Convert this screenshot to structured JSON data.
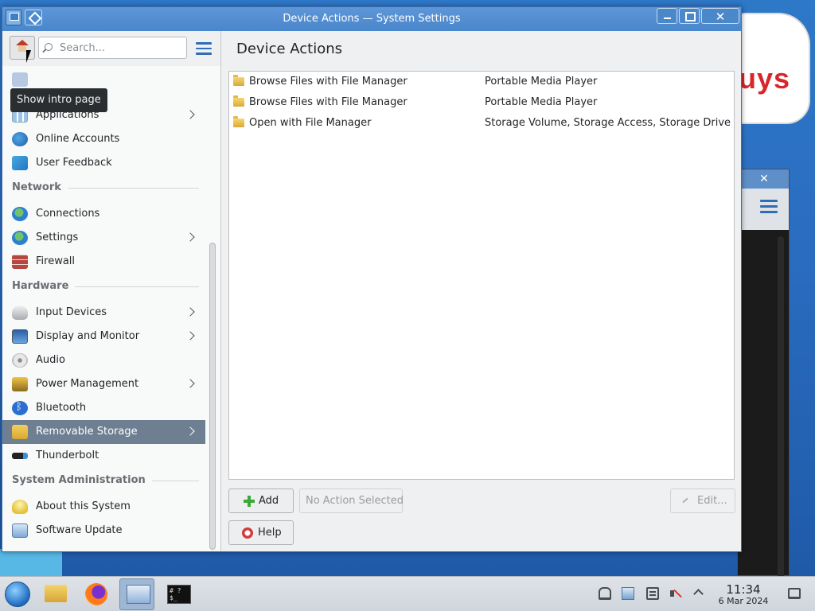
{
  "window": {
    "title": "Device Actions — System Settings"
  },
  "search": {
    "placeholder": "Search..."
  },
  "tooltip": "Show intro page",
  "sidebar": {
    "items": [
      {
        "label": "Applications",
        "icon": "applications-icon",
        "has_children": true
      },
      {
        "label": "Online Accounts",
        "icon": "online-accounts-icon",
        "has_children": false
      },
      {
        "label": "User Feedback",
        "icon": "user-feedback-icon",
        "has_children": false
      },
      {
        "label": "Connections",
        "icon": "connections-icon",
        "has_children": false
      },
      {
        "label": "Settings",
        "icon": "network-settings-icon",
        "has_children": true
      },
      {
        "label": "Firewall",
        "icon": "firewall-icon",
        "has_children": false
      },
      {
        "label": "Input Devices",
        "icon": "input-devices-icon",
        "has_children": true
      },
      {
        "label": "Display and Monitor",
        "icon": "display-icon",
        "has_children": true
      },
      {
        "label": "Audio",
        "icon": "audio-icon",
        "has_children": false
      },
      {
        "label": "Power Management",
        "icon": "power-icon",
        "has_children": true
      },
      {
        "label": "Bluetooth",
        "icon": "bluetooth-icon",
        "has_children": false
      },
      {
        "label": "Removable Storage",
        "icon": "removable-storage-icon",
        "has_children": true,
        "selected": true
      },
      {
        "label": "Thunderbolt",
        "icon": "thunderbolt-icon",
        "has_children": false
      },
      {
        "label": "About this System",
        "icon": "about-system-icon",
        "has_children": false
      },
      {
        "label": "Software Update",
        "icon": "software-update-icon",
        "has_children": false
      }
    ],
    "categories": {
      "network": "Network",
      "hardware": "Hardware",
      "system_administration": "System Administration"
    }
  },
  "content": {
    "title": "Device Actions",
    "actions": [
      {
        "name": "Browse Files with File Manager",
        "devices": "Portable Media Player"
      },
      {
        "name": "Browse Files with File Manager",
        "devices": "Portable Media Player"
      },
      {
        "name": "Open with File Manager",
        "devices": "Storage Volume, Storage Access, Storage Drive"
      }
    ],
    "buttons": {
      "add": "Add",
      "no_action": "No Action Selected",
      "edit": "Edit...",
      "help": "Help"
    }
  },
  "background": {
    "bubble_text": "uys"
  },
  "taskbar": {
    "clock_time": "11:34",
    "clock_date": "6 Mar 2024",
    "terminal_text": "# ?$_"
  },
  "colors": {
    "accent": "#2f6db5",
    "selection": "#6d7f91",
    "titlebar": "#4a86cb"
  }
}
